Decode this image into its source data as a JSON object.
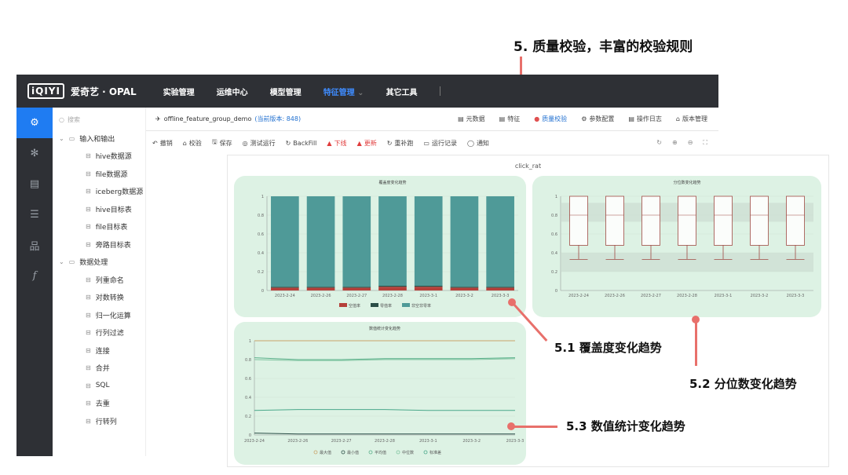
{
  "annotations": {
    "quality": "5. 质量校验，丰富的校验规则",
    "coverage": "5.1 覆盖度变化趋势",
    "quantile": "5.2 分位数变化趋势",
    "numeric": "5.3 数值统计变化趋势"
  },
  "app": {
    "logo": "iQIYI",
    "brand": "爱奇艺 · OPAL",
    "nav": [
      "实验管理",
      "运维中心",
      "模型管理",
      "特征管理",
      "其它工具"
    ],
    "nav_active": "特征管理",
    "sidebar_icons": [
      "settings-icon",
      "gear-icon",
      "document-icon",
      "list-icon",
      "org-chart-icon",
      "function-icon"
    ]
  },
  "tree": {
    "search_placeholder": "搜索",
    "group1": "输入和输出",
    "group1_items": [
      "hive数据源",
      "file数据源",
      "iceberg数据源",
      "hive目标表",
      "file目标表",
      "旁路目标表"
    ],
    "group2": "数据处理",
    "group2_items": [
      "列重命名",
      "对数转换",
      "归一化运算",
      "行列过滤",
      "连接",
      "合并",
      "SQL",
      "去重",
      "行转列"
    ]
  },
  "tabs": {
    "doc_name": "offline_feature_group_demo",
    "doc_version": "(当前版本: 848)",
    "right": [
      "元数据",
      "特征",
      "质量校验",
      "参数配置",
      "操作日志",
      "版本管理"
    ],
    "active": "质量校验"
  },
  "toolbar": {
    "items": [
      "撤销",
      "校验",
      "保存",
      "测试运行",
      "BackFill",
      "下线",
      "更新",
      "重补跑",
      "运行记录",
      "通知"
    ]
  },
  "panel": {
    "title": "click_rat"
  },
  "chart_data": [
    {
      "type": "bar",
      "title": "覆盖度变化趋势",
      "categories": [
        "2023-2-24",
        "2023-2-26",
        "2023-2-27",
        "2023-2-28",
        "2023-3-1",
        "2023-3-2",
        "2023-3-3"
      ],
      "ylim": [
        0,
        1
      ],
      "yticks": [
        0,
        0.2,
        0.4,
        0.6,
        0.8,
        1
      ],
      "series": [
        {
          "name": "空值率",
          "color": "#b5403a",
          "values": [
            0.03,
            0.03,
            0.03,
            0.04,
            0.04,
            0.03,
            0.03
          ]
        },
        {
          "name": "零值率",
          "color": "#2a4d46",
          "values": [
            0.01,
            0.01,
            0.01,
            0.01,
            0.01,
            0.01,
            0.01
          ]
        },
        {
          "name": "非空非零率",
          "color": "#4f9a98",
          "values": [
            0.96,
            0.96,
            0.96,
            0.95,
            0.95,
            0.96,
            0.96
          ]
        }
      ]
    },
    {
      "type": "box",
      "title": "分位数变化趋势",
      "categories": [
        "2023-2-24",
        "2023-2-26",
        "2023-2-27",
        "2023-2-28",
        "2023-3-1",
        "2023-3-2",
        "2023-3-3"
      ],
      "ylim": [
        0,
        1
      ],
      "yticks": [
        0,
        0.2,
        0.4,
        0.6,
        0.8,
        1
      ],
      "boxes": {
        "min": 0.33,
        "q1": 0.48,
        "median": 0.8,
        "q3": 1.0,
        "max": 1.0
      }
    },
    {
      "type": "line",
      "title": "数值统计变化趋势",
      "categories": [
        "2023-2-24",
        "2023-2-26",
        "2023-2-27",
        "2023-2-28",
        "2023-3-1",
        "2023-3-2",
        "2023-3-3"
      ],
      "ylim": [
        0,
        1
      ],
      "yticks": [
        0,
        0.2,
        0.4,
        0.6,
        0.8,
        1
      ],
      "series": [
        {
          "name": "最大值",
          "color": "#c9a46a",
          "values": [
            1,
            1,
            1,
            1,
            1,
            1,
            1
          ]
        },
        {
          "name": "最小值",
          "color": "#2a4d46",
          "values": [
            0.02,
            0.01,
            0.01,
            0.01,
            0.01,
            0.01,
            0.01
          ]
        },
        {
          "name": "平均值",
          "color": "#5ab08a",
          "values": [
            0.82,
            0.8,
            0.8,
            0.81,
            0.81,
            0.81,
            0.82
          ]
        },
        {
          "name": "中位数",
          "color": "#7fc4a0",
          "values": [
            0.8,
            0.79,
            0.79,
            0.8,
            0.8,
            0.8,
            0.81
          ]
        },
        {
          "name": "标准差",
          "color": "#4aa88a",
          "values": [
            0.26,
            0.27,
            0.27,
            0.27,
            0.26,
            0.26,
            0.26
          ]
        }
      ]
    }
  ]
}
